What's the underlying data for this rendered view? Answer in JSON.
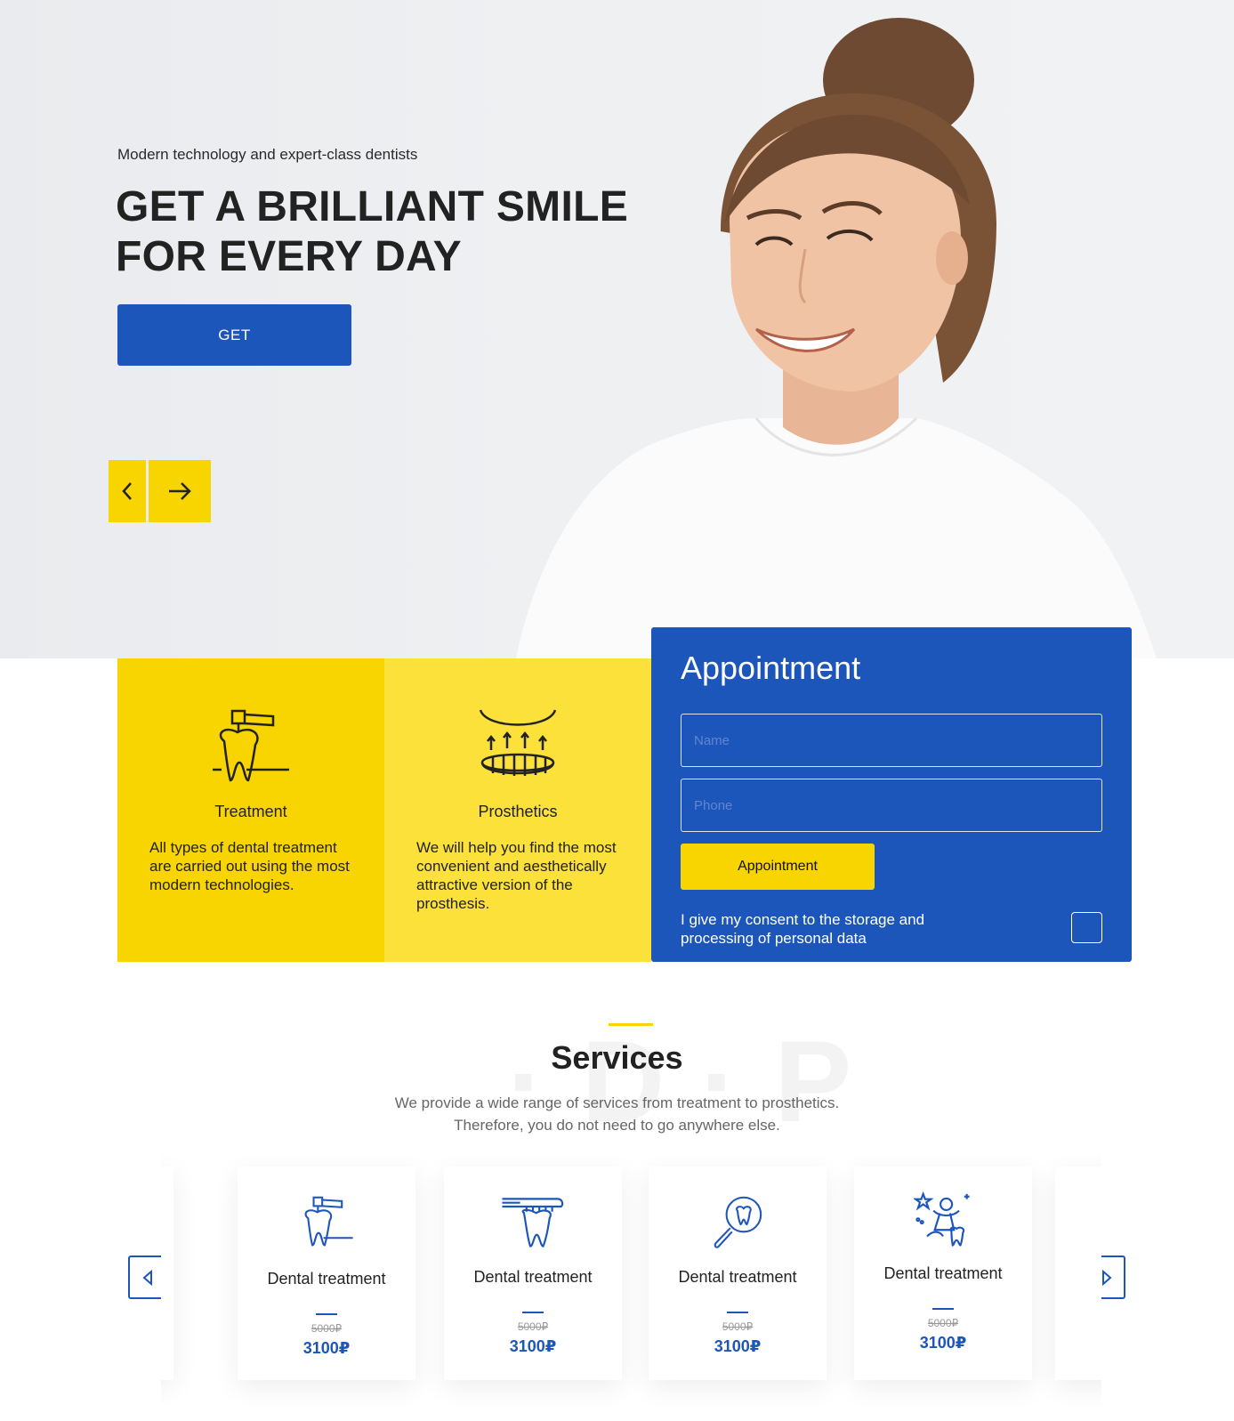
{
  "hero": {
    "subtitle": "Modern technology and expert-class dentists",
    "title_line1": "GET A BRILLIANT SMILE",
    "title_line2": "FOR EVERY DAY",
    "button_label": "GET",
    "prev_icon": "chevron-left-icon",
    "next_icon": "arrow-right-icon"
  },
  "features": [
    {
      "icon": "dental-drill-tooth-icon",
      "title": "Treatment",
      "text": "All types of dental treatment are carried out using the most modern technologies."
    },
    {
      "icon": "denture-prosthesis-icon",
      "title": "Prosthetics",
      "text": "We will help you find the most convenient and aesthetically attractive version of the prosthesis."
    }
  ],
  "appointment": {
    "title": "Appointment",
    "name_placeholder": "Name",
    "phone_placeholder": "Phone",
    "button_label": "Appointment",
    "consent_text": "I give my consent to the storage and processing of personal data"
  },
  "services": {
    "title": "Services",
    "desc_line1": "We provide a wide range of services from treatment to prosthetics.",
    "desc_line2": "Therefore, you do not need to go anywhere else.",
    "cards": [
      {
        "icon": "dental-drill-tooth-icon",
        "title": "Dental treatment",
        "old_price": "5000₽",
        "new_price": "3100₽"
      },
      {
        "icon": "toothbrush-tooth-icon",
        "title": "Dental treatment",
        "old_price": "5000₽",
        "new_price": "3100₽"
      },
      {
        "icon": "magnifier-tooth-icon",
        "title": "Dental treatment",
        "old_price": "5000₽",
        "new_price": "3100₽"
      },
      {
        "icon": "tooth-fairy-icon",
        "title": "Dental treatment",
        "old_price": "5000₽",
        "new_price": "3100₽"
      }
    ]
  },
  "colors": {
    "primary_blue": "#1d56bb",
    "accent_yellow": "#f8d400",
    "light_yellow": "#fbe13a"
  }
}
